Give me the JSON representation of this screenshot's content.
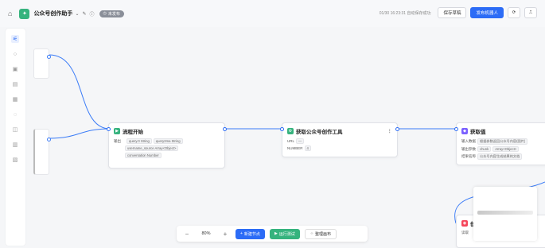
{
  "header": {
    "home_icon": "home-icon",
    "app_title": "公众号创作助手",
    "status_badge": "未发布",
    "save_status": "01/30 16:23:31 自动保存成功",
    "save_button": "保存草稿",
    "publish_button": "发布机器人"
  },
  "sidebar": {
    "icons": [
      "workflow-icon",
      "chat-icon",
      "knowledge-icon",
      "plugin-icon",
      "database-icon",
      "variable-icon",
      "message-icon",
      "document-icon",
      "settings-icon"
    ]
  },
  "nodes": {
    "start": {
      "title": "流程开始",
      "row_label": "输出",
      "tags": [
        [
          "query.0",
          "String"
        ],
        [
          "query2ma",
          "String"
        ],
        [
          "username_source",
          "Array<Object>"
        ],
        [
          "conversation",
          "Number"
        ]
      ]
    },
    "middle": {
      "title": "获取公众号创作工具",
      "rows": [
        [
          "URL",
          "—"
        ],
        [
          "NUMBER",
          "4"
        ]
      ]
    },
    "right": {
      "title": "获取值",
      "rows": [
        [
          "输入数据",
          "根据参数返回公众号内容(图片)"
        ],
        [
          "输出参数",
          "chunk",
          "Array<Object>"
        ],
        [
          "结果名称",
          "公众号内容生成结果的文档"
        ]
      ]
    },
    "lower": {
      "title": "创",
      "desc": "读取"
    }
  },
  "bottom": {
    "zoom": "80%",
    "add_node": "新建节点",
    "run_test": "运行测试",
    "organize": "整理画布"
  },
  "colors": {
    "primary": "#2c6cf6",
    "green": "#36b37e",
    "purple": "#7b61ff",
    "red": "#f5465b"
  }
}
